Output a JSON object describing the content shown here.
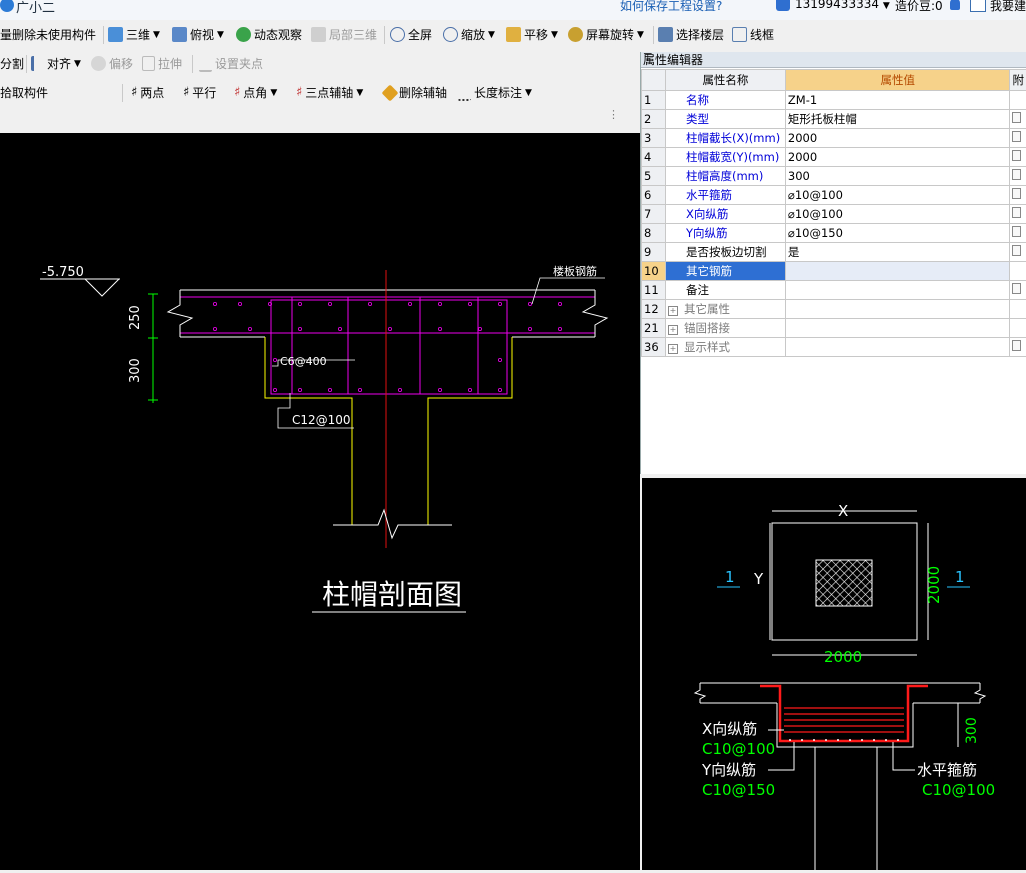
{
  "app": {
    "title": "广小二",
    "help_link": "如何保存工程设置?",
    "user": "13199433334",
    "bean": "造价豆:0",
    "feedback": "我要建"
  },
  "toolbar1": {
    "delete_unused": "量删除未使用构件",
    "view3d": "三维",
    "top_view": "俯视",
    "dynamic_observe": "动态观察",
    "partial3d": "局部三维",
    "fullscreen": "全屏",
    "zoom": "缩放",
    "pan": "平移",
    "screen_rotate": "屏幕旋转",
    "select_floor": "选择楼层",
    "wireframe": "线框"
  },
  "toolbar2": {
    "split": "分割",
    "align": "对齐",
    "offset": "偏移",
    "stretch": "拉伸",
    "set_grip": "设置夹点"
  },
  "toolbar3": {
    "pick_component": "拾取构件",
    "two_points": "两点",
    "parallel": "平行",
    "point_angle": "点角",
    "three_point_aux": "三点辅轴",
    "delete_aux": "删除辅轴",
    "length_dim": "长度标注"
  },
  "property_editor": {
    "title": "属性编辑器",
    "col_name": "属性名称",
    "col_value": "属性值",
    "col_attach": "附",
    "rows": [
      {
        "num": "1",
        "name": "名称",
        "value": "ZM-1",
        "style": "blue",
        "check": false
      },
      {
        "num": "2",
        "name": "类型",
        "value": "矩形托板柱帽",
        "style": "blue",
        "check": true
      },
      {
        "num": "3",
        "name": "柱帽截长(X)(mm)",
        "value": "2000",
        "style": "blue",
        "check": true
      },
      {
        "num": "4",
        "name": "柱帽截宽(Y)(mm)",
        "value": "2000",
        "style": "blue",
        "check": true
      },
      {
        "num": "5",
        "name": "柱帽高度(mm)",
        "value": "300",
        "style": "blue",
        "check": true
      },
      {
        "num": "6",
        "name": "水平箍筋",
        "value": "⌀10@100",
        "style": "blue",
        "check": true
      },
      {
        "num": "7",
        "name": "X向纵筋",
        "value": "⌀10@100",
        "style": "blue",
        "check": true
      },
      {
        "num": "8",
        "name": "Y向纵筋",
        "value": "⌀10@150",
        "style": "blue",
        "check": true
      },
      {
        "num": "9",
        "name": "是否按板边切割",
        "value": "是",
        "style": "black",
        "check": true
      },
      {
        "num": "10",
        "name": "其它钢筋",
        "value": "",
        "style": "selected",
        "check": false
      },
      {
        "num": "11",
        "name": "备注",
        "value": "",
        "style": "black",
        "check": true
      },
      {
        "num": "12",
        "name": "其它属性",
        "value": "",
        "style": "group",
        "check": false
      },
      {
        "num": "21",
        "name": "锚固搭接",
        "value": "",
        "style": "group",
        "check": false
      },
      {
        "num": "36",
        "name": "显示样式",
        "value": "",
        "style": "group",
        "check": true
      }
    ]
  },
  "section_drawing": {
    "elevation": "-5.750",
    "dim_250": "250",
    "dim_300": "300",
    "slab_rebar": "楼板钢筋",
    "stirrup": "C6@400",
    "bottom_rebar": "C12@100",
    "title": "柱帽剖面图"
  },
  "detail_drawing": {
    "x_label": "X",
    "y_label": "Y",
    "section_mark": "1",
    "dim_2000_h": "2000",
    "dim_2000_v": "2000",
    "dim_300": "300",
    "x_rebar_label": "X向纵筋",
    "x_rebar_value": "C10@100",
    "y_rebar_label": "Y向纵筋",
    "y_rebar_value": "C10@150",
    "stirrup_label": "水平箍筋",
    "stirrup_value": "C10@100"
  }
}
